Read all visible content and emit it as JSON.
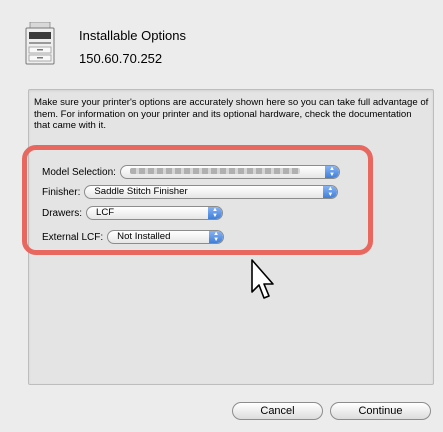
{
  "header": {
    "title": "Installable Options",
    "address": "150.60.70.252"
  },
  "message": "Make sure your printer's options are accurately shown here so you can take full advantage of them.  For information on your printer and its optional hardware, check the documentation that came with it.",
  "options": {
    "model_label": "Model Selection:",
    "model_value": "",
    "finisher_label": "Finisher:",
    "finisher_value": "Saddle Stitch Finisher",
    "drawers_label": "Drawers:",
    "drawers_value": "LCF",
    "external_lcf_label": "External LCF:",
    "external_lcf_value": "Not Installed"
  },
  "buttons": {
    "cancel": "Cancel",
    "continue": "Continue"
  },
  "colors": {
    "highlight": "#e8675f",
    "stepper": "#3f7fd8"
  },
  "icons": {
    "printer": "printer-icon",
    "cursor": "mouse-pointer-icon",
    "popup": "up-down-arrows-icon"
  }
}
